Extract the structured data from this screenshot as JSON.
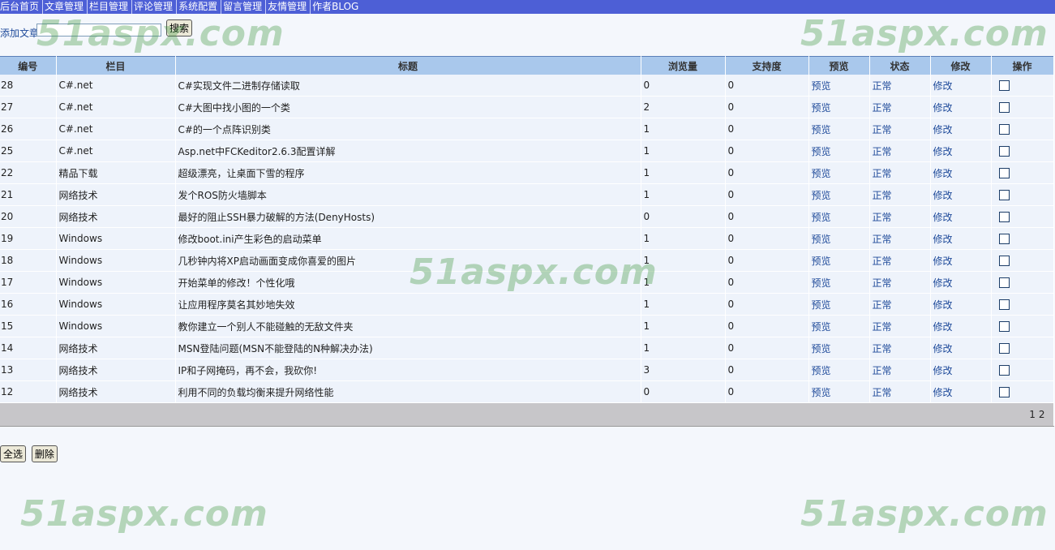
{
  "nav": {
    "items": [
      "后台首页",
      "文章管理",
      "栏目管理",
      "评论管理",
      "系统配置",
      "留言管理",
      "友情管理",
      "作者BLOG"
    ]
  },
  "toolbar": {
    "add_article": "添加文章",
    "search_value": "",
    "search_button": "搜索"
  },
  "table": {
    "headers": [
      "编号",
      "栏目",
      "标题",
      "浏览量",
      "支持度",
      "预览",
      "状态",
      "修改",
      "操作"
    ],
    "preview_label": "预览",
    "status_label": "正常",
    "edit_label": "修改",
    "rows": [
      {
        "id": "28",
        "category": "C#.net",
        "title": "C#实现文件二进制存储读取",
        "views": "0",
        "support": "0"
      },
      {
        "id": "27",
        "category": "C#.net",
        "title": "C#大图中找小图的一个类",
        "views": "2",
        "support": "0"
      },
      {
        "id": "26",
        "category": "C#.net",
        "title": "C#的一个点阵识别类",
        "views": "1",
        "support": "0"
      },
      {
        "id": "25",
        "category": "C#.net",
        "title": "Asp.net中FCKeditor2.6.3配置详解",
        "views": "1",
        "support": "0"
      },
      {
        "id": "22",
        "category": "精品下载",
        "title": "超级漂亮，让桌面下雪的程序",
        "views": "1",
        "support": "0"
      },
      {
        "id": "21",
        "category": "网络技术",
        "title": "发个ROS防火墙脚本",
        "views": "1",
        "support": "0"
      },
      {
        "id": "20",
        "category": "网络技术",
        "title": "最好的阻止SSH暴力破解的方法(DenyHosts)",
        "views": "0",
        "support": "0"
      },
      {
        "id": "19",
        "category": "Windows",
        "title": "修改boot.ini产生彩色的启动菜单",
        "views": "1",
        "support": "0"
      },
      {
        "id": "18",
        "category": "Windows",
        "title": "几秒钟内将XP启动画面变成你喜爱的图片",
        "views": "1",
        "support": "0"
      },
      {
        "id": "17",
        "category": "Windows",
        "title": "开始菜单的修改！个性化哦",
        "views": "1",
        "support": "0"
      },
      {
        "id": "16",
        "category": "Windows",
        "title": "让应用程序莫名其妙地失效",
        "views": "1",
        "support": "0"
      },
      {
        "id": "15",
        "category": "Windows",
        "title": "教你建立一个别人不能碰触的无敌文件夹",
        "views": "1",
        "support": "0"
      },
      {
        "id": "14",
        "category": "网络技术",
        "title": "MSN登陆问题(MSN不能登陆的N种解决办法)",
        "views": "1",
        "support": "0"
      },
      {
        "id": "13",
        "category": "网络技术",
        "title": "IP和子网掩码，再不会，我砍你!",
        "views": "3",
        "support": "0"
      },
      {
        "id": "12",
        "category": "网络技术",
        "title": "利用不同的负载均衡来提升网络性能",
        "views": "0",
        "support": "0"
      }
    ],
    "pages": [
      "1",
      "2"
    ]
  },
  "bottom": {
    "select_all": "全选",
    "delete": "删除"
  },
  "watermark": "51aspx.com",
  "colors": {
    "nav_bg": "#4d5fd6",
    "header_bg": "#a9c8ec",
    "link": "#1e4a9a",
    "footer_bg": "#c7c6c9"
  }
}
